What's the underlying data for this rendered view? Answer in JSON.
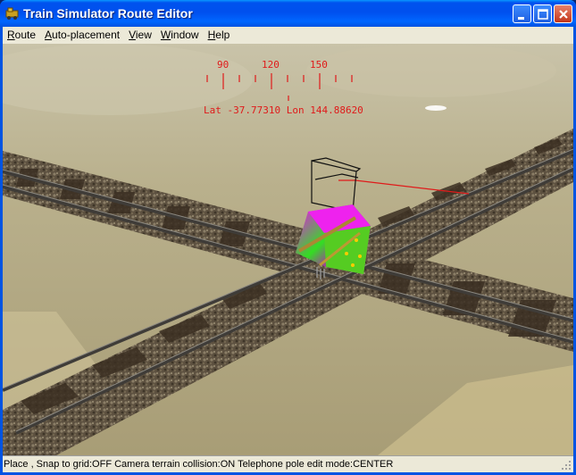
{
  "window": {
    "title": "Train Simulator Route Editor"
  },
  "titlebar_buttons": {
    "minimize": "minimize-icon",
    "maximize": "maximize-icon",
    "close": "close-icon"
  },
  "menu": [
    {
      "label": "Route",
      "mnemonic": "R"
    },
    {
      "label": "Auto-placement",
      "mnemonic": "A"
    },
    {
      "label": "View",
      "mnemonic": "V"
    },
    {
      "label": "Window",
      "mnemonic": "W"
    },
    {
      "label": "Help",
      "mnemonic": "H"
    }
  ],
  "hud": {
    "compass_labels": [
      "90",
      "120",
      "150"
    ],
    "lat_lon": "Lat -37.77310 Lon 144.88620",
    "color": "#e01a1a"
  },
  "status": {
    "text": "Place , Snap to grid:OFF Camera terrain collision:ON Telephone pole edit mode:CENTER"
  },
  "colors": {
    "title_bar": "#0054e3",
    "menu_bg": "#ece9d8",
    "terrain_far": "#bdb493",
    "ballast": "#6b5d4a",
    "rail": "#4a4742",
    "missing_texture": "#ff00ff"
  }
}
